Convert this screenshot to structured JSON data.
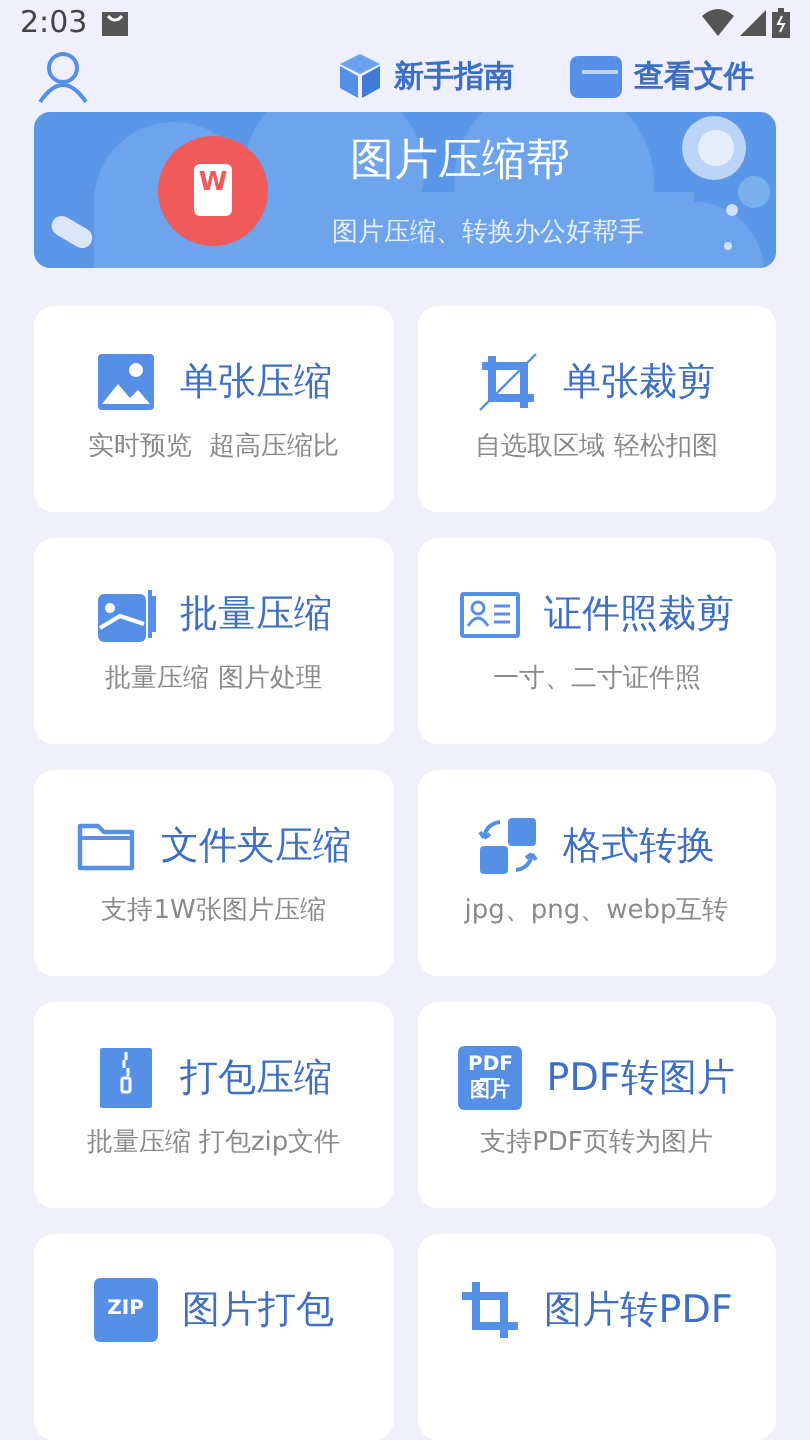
{
  "status_bar": {
    "time": "2:03"
  },
  "header": {
    "actions": [
      {
        "kind": "cube",
        "label": "新手指南"
      },
      {
        "kind": "folder",
        "label": "查看文件"
      }
    ]
  },
  "banner": {
    "logo_text": "W",
    "title": "图片压缩帮",
    "subtitle": "图片压缩、转换办公好帮手"
  },
  "cards": [
    {
      "kind": "image",
      "title": "单张压缩",
      "subtitle": "实时预览  超高压缩比"
    },
    {
      "kind": "crop",
      "title": "单张裁剪",
      "subtitle": "自选取区域 轻松扣图"
    },
    {
      "kind": "batch",
      "title": "批量压缩",
      "subtitle": "批量压缩 图片处理"
    },
    {
      "kind": "idcard",
      "title": "证件照裁剪",
      "subtitle": "一寸、二寸证件照"
    },
    {
      "kind": "folder",
      "title": "文件夹压缩",
      "subtitle": "支持1W张图片压缩"
    },
    {
      "kind": "convert",
      "title": "格式转换",
      "subtitle": "jpg、png、webp互转"
    },
    {
      "kind": "zipper",
      "title": "打包压缩",
      "subtitle": "批量压缩 打包zip文件"
    },
    {
      "kind": "pdf",
      "title": "PDF转图片",
      "subtitle": "支持PDF页转为图片",
      "icon_text": [
        "PDF",
        "图片"
      ]
    },
    {
      "kind": "zipfile",
      "title": "图片打包",
      "icon_text": [
        "ZIP"
      ]
    },
    {
      "kind": "crop2",
      "title": "图片转PDF"
    }
  ]
}
